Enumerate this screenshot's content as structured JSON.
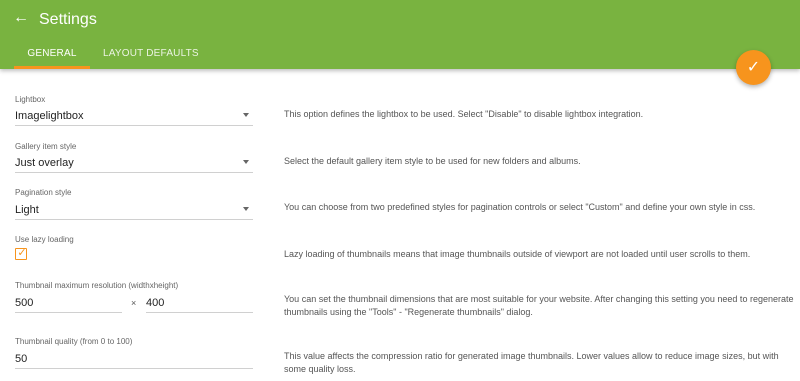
{
  "header": {
    "title": "Settings",
    "back_icon": "arrow-back-icon",
    "tabs": [
      {
        "label": "GENERAL",
        "active": true
      },
      {
        "label": "LAYOUT DEFAULTS",
        "active": false
      }
    ],
    "save_icon": "checkmark-icon"
  },
  "colors": {
    "appbar": "#79b340",
    "accent": "#f7941d"
  },
  "settings": {
    "lightbox": {
      "label": "Lightbox",
      "value": "Imagelightbox",
      "description": "This option defines the lightbox to be used. Select \"Disable\" to disable lightbox integration."
    },
    "gallery_item_style": {
      "label": "Gallery item style",
      "value": "Just overlay",
      "description": "Select the default gallery item style to be used for new folders and albums."
    },
    "pagination_style": {
      "label": "Pagination style",
      "value": "Light",
      "description": "You can choose from two predefined styles for pagination controls or select \"Custom\" and define your own style in css."
    },
    "lazy_loading": {
      "label": "Use lazy loading",
      "checked": true,
      "description": "Lazy loading of thumbnails means that image thumbnails outside of viewport are not loaded until user scrolls to them."
    },
    "thumbnail_resolution": {
      "label": "Thumbnail maximum resolution (widthxheight)",
      "width": "500",
      "separator": "×",
      "height": "400",
      "description": "You can set the thumbnail dimensions that are most suitable for your website. After changing this setting you need to regenerate thumbnails using the \"Tools\" - \"Regenerate thumbnails\" dialog."
    },
    "thumbnail_quality": {
      "label": "Thumbnail quality (from 0 to 100)",
      "value": "50",
      "description": "This value affects the compression ratio for generated image thumbnails. Lower values allow to reduce image sizes, but with some quality loss."
    }
  }
}
